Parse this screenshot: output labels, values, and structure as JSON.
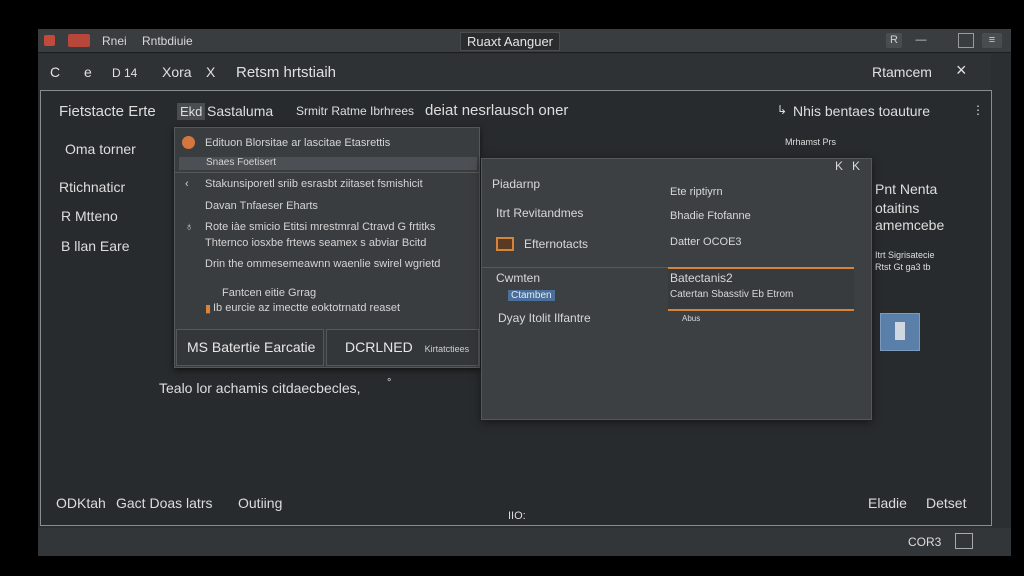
{
  "titlebar": {
    "menu1": "Rnei",
    "menu2": "Rntbdiuie",
    "title": "Ruaxt Aanguer",
    "ctrl_a": "R",
    "ctrl_b": "—",
    "ctrl_d": "≡"
  },
  "navbar": {
    "back": "C",
    "forward": "e",
    "icon_label": "D 14",
    "label": "Xora",
    "tool": "X",
    "path": "Retsm hrtstiaih",
    "right_label": "Rtamcem",
    "close": "×"
  },
  "main": {
    "left_title": "Fietstacte Erte",
    "left_sub": "Oma torner",
    "left_items": [
      "Rtichnaticr",
      "R Mtteno",
      "B llan Eare"
    ],
    "search_tag": "Ekd",
    "search_label": "Sastaluma",
    "search_desc": "Srmitr Ratme Ibrhrees",
    "search_main": "deiat nesrlausch oner",
    "right_header": "Nhis bentaes toauture",
    "right_meta": "Mrhamst Prs",
    "right_items": [
      "Pnt Nenta",
      "otaitins",
      "amemcebe"
    ],
    "right_small": "Itrt Sigrisatecie",
    "right_small2": "Rtst Gt ga3 tb",
    "bottom_text": "Tealo lor achamis citdaecbecles,",
    "bottom_mark": "°"
  },
  "dropdown": {
    "header": "Edituon Blorsitae ar lascitae Etasrettis",
    "selected": "Snaes Foetisert",
    "rows": [
      "Stakunsiporetl sriib esrasbt ziitaset fsmishicit",
      "Davan Tnfaeser Eharts",
      "Rote iàe smicio Etitsi mrestmral Ctravd G frtitks",
      "Thternco iosxbe frtews seamex s abviar Bcitd",
      "Drin the ommesemeawnn waenlie swirel wgrietd",
      "Fantcen eitie Grrag",
      "Ib eurcie az imectte eoktotrnatd reaset"
    ],
    "btn_left": "MS Batertie Earcatie",
    "btn_right_main": "DCRLNED",
    "btn_right_sub": "Kirtatctiees"
  },
  "panel": {
    "ctl1": "K",
    "ctl2": "K",
    "l1": "Piadarnp",
    "l2": "Itrt Revitandmes",
    "l3": "Efternotacts",
    "l4": "Cwmten",
    "l5": "Ctamben",
    "l6": "Dyay Itolit Ilfantre",
    "r1": "Ete riptiyrn",
    "r2": "Bhadie Ftofanne",
    "r3": "Datter OCOE3",
    "r4": "Batectanis2",
    "r5": "Catertan Sbasstiv Eb Etrom",
    "r6": "Abus"
  },
  "statusbar": {
    "left": [
      "ODKtah",
      "Gact Doas latrs",
      "Outiing"
    ],
    "center": "IIO:",
    "right": [
      "Eladie",
      "Detset"
    ],
    "code": "COR3"
  },
  "colors": {
    "accent": "#d6843a",
    "window_bg": "#2c2f31",
    "badge": "#b8473b",
    "thumb": "#5a7fa8"
  }
}
